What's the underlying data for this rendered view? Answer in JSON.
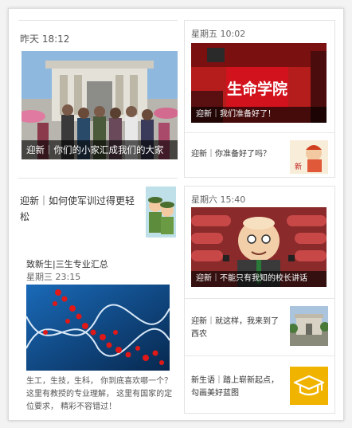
{
  "left": {
    "card1": {
      "time": "昨天 18:12",
      "caption": "迎新｜你们的小家汇成我们的大家"
    },
    "card2": {
      "title": "迎新｜如何使军训过得更轻松"
    },
    "card3": {
      "title": "致新生|三生专业汇总",
      "time": "星期三 23:15",
      "desc": "生工，生技，生科， 你到底喜欢哪一个？这里有教授的专业理解， 这里有国家的定位要求， 精彩不容错过！"
    }
  },
  "right": {
    "group1": {
      "time": "星期五 10:02",
      "caption": "迎新｜我们准备好了！",
      "sign_text": "生命学院",
      "row_text": "迎新｜你准备好了吗？"
    },
    "group2": {
      "time": "星期六 15:40",
      "caption": "迎新｜不能只有我知的校长讲话",
      "row1_text": "迎新｜就这样，我来到了西农",
      "row2_text": "新生语｜踏上崭新起点，勾画美好蓝图"
    }
  },
  "colors": {
    "accent_orange": "#f0b400",
    "caption_bg": "#000000",
    "sign_red": "#d2121c"
  }
}
